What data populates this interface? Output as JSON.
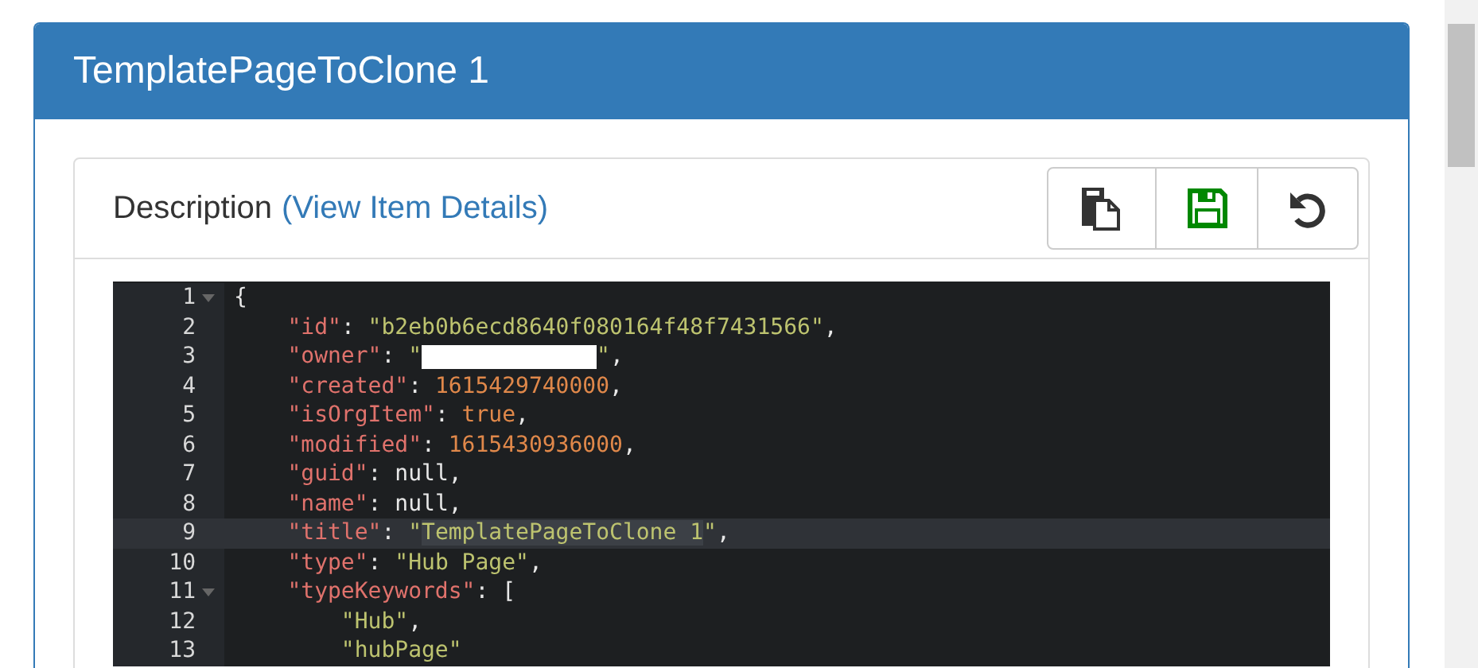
{
  "panel": {
    "title": "TemplatePageToClone 1"
  },
  "section": {
    "label": "Description",
    "link": "(View Item Details)",
    "toolbar": [
      {
        "kind": "copy"
      },
      {
        "kind": "save"
      },
      {
        "kind": "undo"
      }
    ]
  },
  "editor": {
    "lines": [
      {
        "number": "1",
        "fold": true,
        "active": false,
        "tokens": [
          {
            "kind": "punct",
            "text": "{"
          }
        ]
      },
      {
        "number": "2",
        "fold": false,
        "active": false,
        "tokens": [
          {
            "kind": "key",
            "text": "    \"id\""
          },
          {
            "kind": "punct",
            "text": ": "
          },
          {
            "kind": "str",
            "text": "\"b2eb0b6ecd8640f080164f48f7431566\""
          },
          {
            "kind": "punct",
            "text": ","
          }
        ]
      },
      {
        "number": "3",
        "fold": false,
        "active": false,
        "tokens": [
          {
            "kind": "key",
            "text": "    \"owner\""
          },
          {
            "kind": "punct",
            "text": ": "
          },
          {
            "kind": "str",
            "text": "\""
          },
          {
            "kind": "redacted"
          },
          {
            "kind": "str",
            "text": "\""
          },
          {
            "kind": "punct",
            "text": ","
          }
        ]
      },
      {
        "number": "4",
        "fold": false,
        "active": false,
        "tokens": [
          {
            "kind": "key",
            "text": "    \"created\""
          },
          {
            "kind": "punct",
            "text": ": "
          },
          {
            "kind": "num",
            "text": "1615429740000"
          },
          {
            "kind": "punct",
            "text": ","
          }
        ]
      },
      {
        "number": "5",
        "fold": false,
        "active": false,
        "tokens": [
          {
            "kind": "key",
            "text": "    \"isOrgItem\""
          },
          {
            "kind": "punct",
            "text": ": "
          },
          {
            "kind": "num",
            "text": "true"
          },
          {
            "kind": "punct",
            "text": ","
          }
        ]
      },
      {
        "number": "6",
        "fold": false,
        "active": false,
        "tokens": [
          {
            "kind": "key",
            "text": "    \"modified\""
          },
          {
            "kind": "punct",
            "text": ": "
          },
          {
            "kind": "num",
            "text": "1615430936000"
          },
          {
            "kind": "punct",
            "text": ","
          }
        ]
      },
      {
        "number": "7",
        "fold": false,
        "active": false,
        "tokens": [
          {
            "kind": "key",
            "text": "    \"guid\""
          },
          {
            "kind": "punct",
            "text": ": null,"
          }
        ]
      },
      {
        "number": "8",
        "fold": false,
        "active": false,
        "tokens": [
          {
            "kind": "key",
            "text": "    \"name\""
          },
          {
            "kind": "punct",
            "text": ": null,"
          }
        ]
      },
      {
        "number": "9",
        "fold": false,
        "active": true,
        "tokens": [
          {
            "kind": "key",
            "text": "    \"title\""
          },
          {
            "kind": "punct",
            "text": ": "
          },
          {
            "kind": "str",
            "text": "\""
          },
          {
            "kind": "selected",
            "text": "TemplatePageToClone 1"
          },
          {
            "kind": "str",
            "text": "\""
          },
          {
            "kind": "punct",
            "text": ","
          }
        ]
      },
      {
        "number": "10",
        "fold": false,
        "active": false,
        "tokens": [
          {
            "kind": "key",
            "text": "    \"type\""
          },
          {
            "kind": "punct",
            "text": ": "
          },
          {
            "kind": "str",
            "text": "\"Hub Page\""
          },
          {
            "kind": "punct",
            "text": ","
          }
        ]
      },
      {
        "number": "11",
        "fold": true,
        "active": false,
        "tokens": [
          {
            "kind": "key",
            "text": "    \"typeKeywords\""
          },
          {
            "kind": "punct",
            "text": ": ["
          }
        ]
      },
      {
        "number": "12",
        "fold": false,
        "active": false,
        "tokens": [
          {
            "kind": "str",
            "text": "        \"Hub\""
          },
          {
            "kind": "punct",
            "text": ","
          }
        ]
      },
      {
        "number": "13",
        "fold": false,
        "active": false,
        "tokens": [
          {
            "kind": "str",
            "text": "        \"hubPage\""
          }
        ]
      }
    ]
  }
}
